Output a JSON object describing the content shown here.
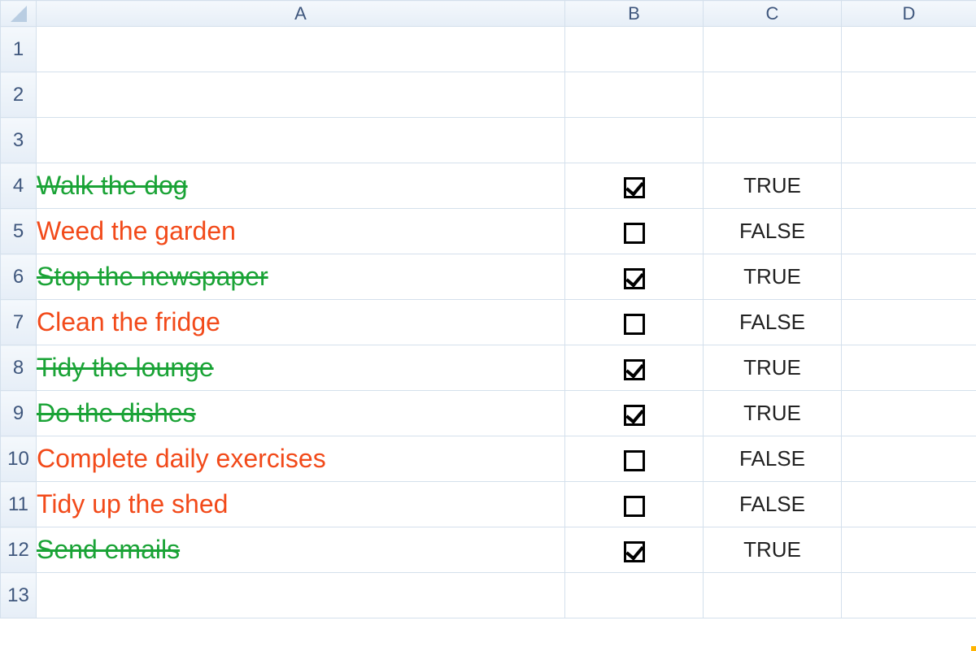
{
  "columns": [
    "A",
    "B",
    "C",
    "D"
  ],
  "row_numbers": [
    1,
    2,
    3,
    4,
    5,
    6,
    7,
    8,
    9,
    10,
    11,
    12,
    13
  ],
  "tasks": [
    {
      "text": "Walk the dog",
      "checked": true,
      "linked": "TRUE"
    },
    {
      "text": "Weed the garden",
      "checked": false,
      "linked": "FALSE"
    },
    {
      "text": "Stop the newspaper",
      "checked": true,
      "linked": "TRUE"
    },
    {
      "text": "Clean the fridge",
      "checked": false,
      "linked": "FALSE"
    },
    {
      "text": "Tidy the lounge",
      "checked": true,
      "linked": "TRUE"
    },
    {
      "text": "Do the dishes",
      "checked": true,
      "linked": "TRUE"
    },
    {
      "text": "Complete daily exercises",
      "checked": false,
      "linked": "FALSE"
    },
    {
      "text": "Tidy up the shed",
      "checked": false,
      "linked": "FALSE"
    },
    {
      "text": "Send emails",
      "checked": true,
      "linked": "TRUE"
    }
  ],
  "task_start_row": 4
}
